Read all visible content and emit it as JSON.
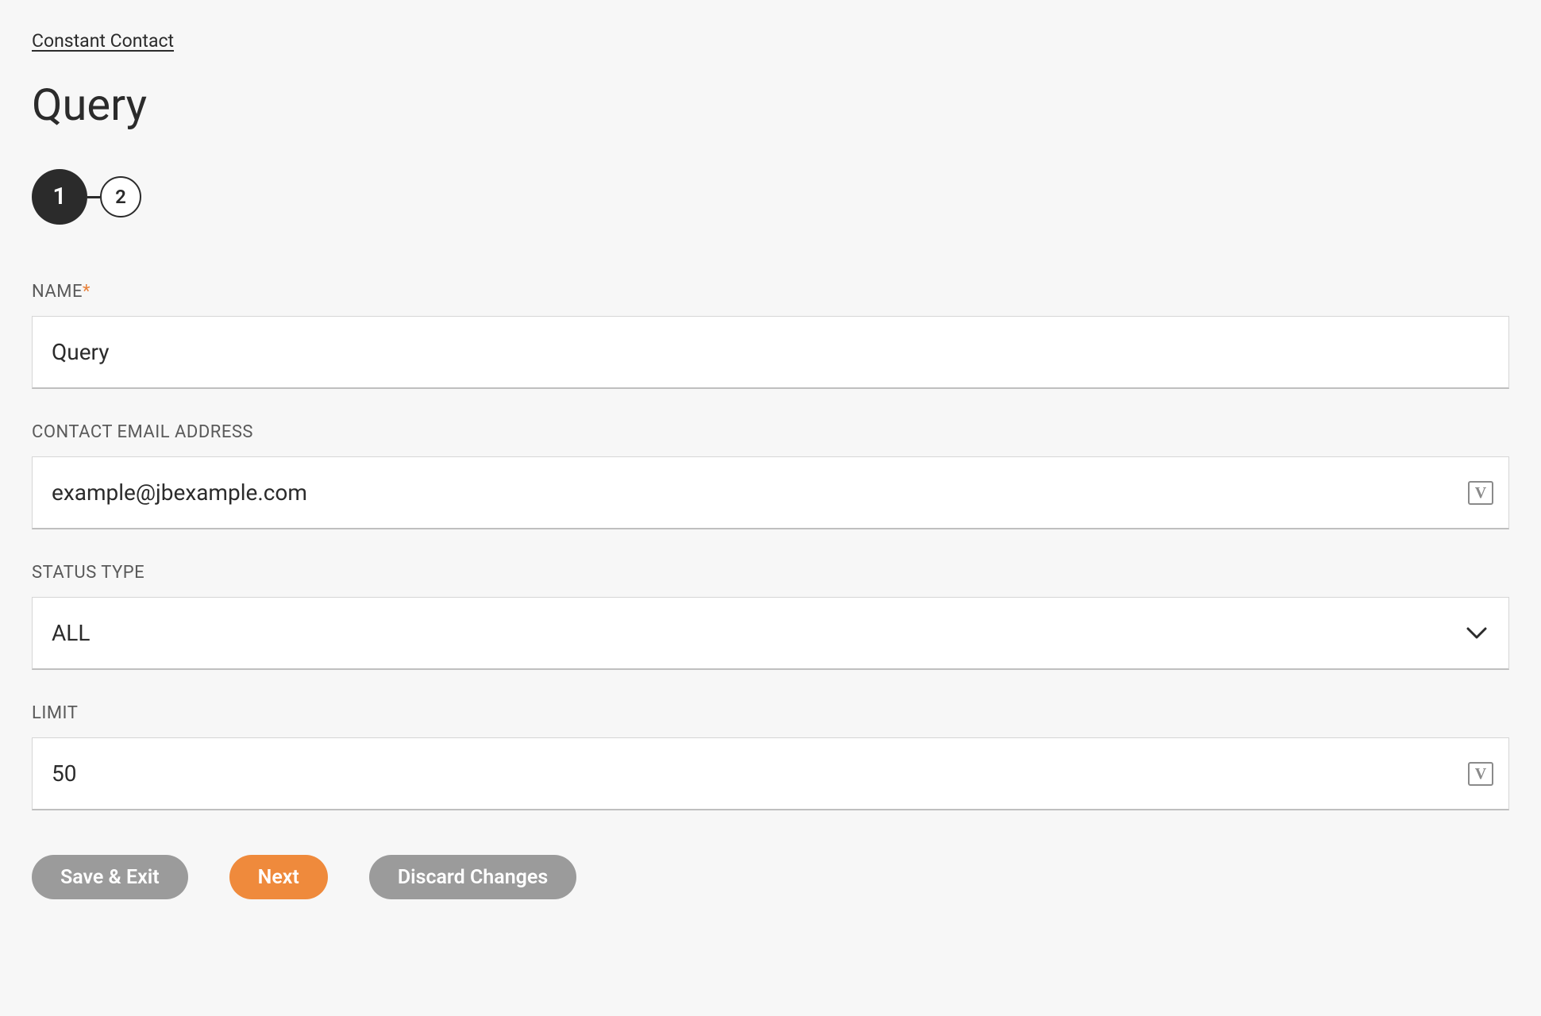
{
  "breadcrumb": {
    "label": "Constant Contact"
  },
  "page_title": "Query",
  "stepper": {
    "steps": [
      "1",
      "2"
    ],
    "active_index": 0
  },
  "fields": {
    "name": {
      "label": "NAME",
      "required_mark": "*",
      "value": "Query"
    },
    "email": {
      "label": "CONTACT EMAIL ADDRESS",
      "value": "example@jbexample.com"
    },
    "status": {
      "label": "STATUS TYPE",
      "value": "ALL"
    },
    "limit": {
      "label": "LIMIT",
      "value": "50"
    }
  },
  "variable_badge": "V",
  "actions": {
    "save_exit": "Save & Exit",
    "next": "Next",
    "discard": "Discard Changes"
  }
}
